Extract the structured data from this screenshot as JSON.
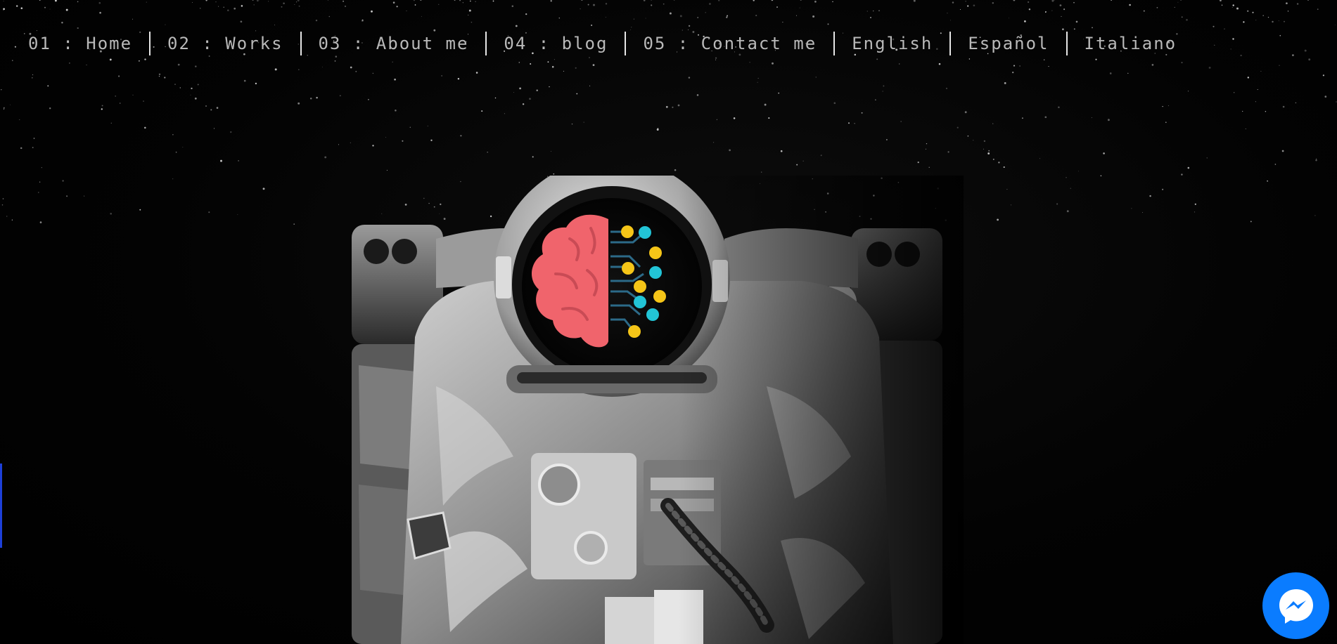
{
  "nav": {
    "items": [
      {
        "label": "01 : Home"
      },
      {
        "label": "02 : Works"
      },
      {
        "label": "03 : About me"
      },
      {
        "label": "04 : blog"
      },
      {
        "label": "05 : Contact me"
      },
      {
        "label": "English"
      },
      {
        "label": "Español"
      },
      {
        "label": "Italiano"
      }
    ]
  },
  "hero": {
    "image": "astronaut-with-brain-circuit-visor",
    "visor_icon": "brain-circuit-icon"
  },
  "chat_widget": {
    "icon": "messenger-icon",
    "color": "#0a7cff"
  },
  "colors": {
    "background": "#000000",
    "nav_text": "#b9b9b9",
    "brain": "#f0646c",
    "circuit_dot_yellow": "#f5c518",
    "circuit_dot_cyan": "#22c4d6"
  }
}
